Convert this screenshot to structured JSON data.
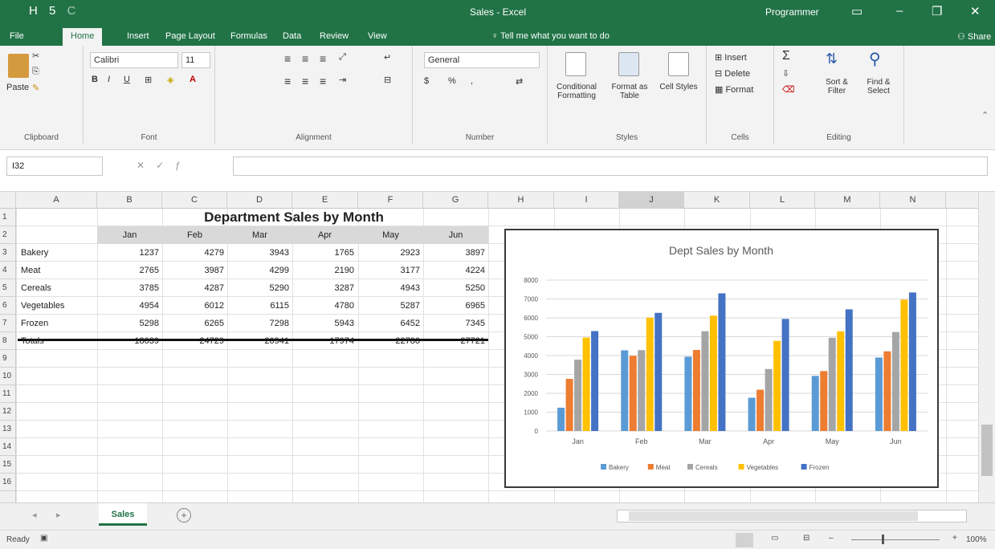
{
  "window": {
    "title": "Sales - Excel",
    "user": "Programmer",
    "qat": [
      "H",
      "5",
      "C"
    ]
  },
  "tabs": [
    "File",
    "Home",
    "Insert",
    "Page Layout",
    "Formulas",
    "Data",
    "Review",
    "View"
  ],
  "tell_me": "Tell me what you want to do",
  "share": "Share",
  "ribbon": {
    "clipboard": {
      "label": "Clipboard",
      "paste": "Paste"
    },
    "font": {
      "label": "Font",
      "name": "Calibri",
      "size": "11",
      "bold": "B",
      "italic": "I",
      "underline": "U"
    },
    "alignment": {
      "label": "Alignment"
    },
    "number": {
      "label": "Number",
      "format": "General",
      "percent": "%"
    },
    "styles": {
      "label": "Styles",
      "conditional": "Conditional Formatting",
      "format_table": "Format as Table",
      "cell_styles": "Cell Styles"
    },
    "cells": {
      "label": "Cells",
      "insert": "Insert",
      "delete": "Delete",
      "format": "Format"
    },
    "editing": {
      "label": "Editing",
      "sort_filter": "Sort & Filter",
      "find_select": "Find & Select"
    }
  },
  "formula_bar": {
    "name_box": "I32",
    "value": ""
  },
  "columns": [
    "A",
    "B",
    "C",
    "D",
    "E",
    "F",
    "G",
    "H",
    "I",
    "J",
    "K",
    "L",
    "M",
    "N"
  ],
  "rows": [
    "1",
    "2",
    "3",
    "4",
    "5",
    "6",
    "7",
    "8",
    "9",
    "10",
    "11",
    "12",
    "13",
    "14",
    "15",
    "16"
  ],
  "sheet": {
    "title": "Department Sales by Month",
    "months": [
      "Jan",
      "Feb",
      "Mar",
      "Apr",
      "May",
      "Jun"
    ],
    "departments": [
      "Bakery",
      "Meat",
      "Cereals",
      "Vegetables",
      "Frozen"
    ],
    "values": [
      [
        1237,
        4279,
        3943,
        1765,
        2923,
        3897
      ],
      [
        2765,
        3987,
        4299,
        2190,
        3177,
        4224
      ],
      [
        3785,
        4287,
        5290,
        3287,
        4943,
        5250
      ],
      [
        4954,
        6012,
        6115,
        4780,
        5287,
        6965
      ],
      [
        5298,
        6265,
        7298,
        5943,
        6452,
        7345
      ]
    ],
    "totals_label": "Totals",
    "totals": [
      18039,
      24729,
      20941,
      17974,
      22780,
      27721
    ]
  },
  "chart_data": {
    "type": "bar",
    "title": "Dept Sales by Month",
    "categories": [
      "Jan",
      "Feb",
      "Mar",
      "Apr",
      "May",
      "Jun"
    ],
    "series": [
      {
        "name": "Bakery",
        "values": [
          1237,
          4279,
          3943,
          1765,
          2923,
          3897
        ]
      },
      {
        "name": "Meat",
        "values": [
          2765,
          3987,
          4299,
          2190,
          3177,
          4224
        ]
      },
      {
        "name": "Cereals",
        "values": [
          3785,
          4287,
          5290,
          3287,
          4943,
          5250
        ]
      },
      {
        "name": "Vegetables",
        "values": [
          4954,
          6012,
          6115,
          4780,
          5287,
          6965
        ]
      },
      {
        "name": "Frozen",
        "values": [
          5298,
          6265,
          7298,
          5943,
          6452,
          7345
        ]
      }
    ],
    "colors": [
      "#5b9bd5",
      "#ed7d31",
      "#a5a5a5",
      "#ffc000",
      "#4472c4"
    ],
    "ylim": [
      0,
      8000
    ],
    "yticks": [
      "0",
      "1000",
      "2000",
      "3000",
      "4000",
      "5000",
      "6000",
      "7000",
      "8000"
    ],
    "grid": true,
    "legend": "bottom"
  },
  "sheet_tab": "Sales",
  "status": {
    "ready": "Ready",
    "zoom": "100%"
  }
}
